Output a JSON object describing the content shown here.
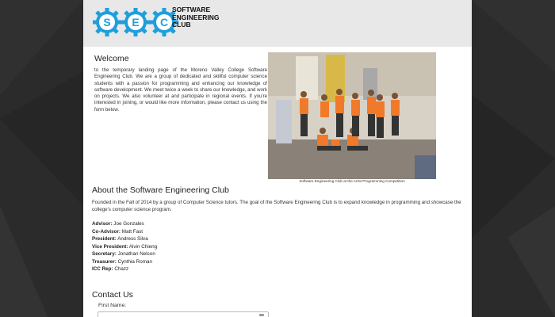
{
  "header": {
    "logo_letters": [
      "S",
      "E",
      "C"
    ],
    "logo_lines": [
      "SOFTWARE",
      "ENGINEERING",
      "CLUB"
    ]
  },
  "welcome": {
    "title": "Welcome",
    "text": "to the temporary landing page of the Moreno Valley College Software Engineering Club. We are a group of dedicated and skillful computer science students with a passion for programming and enhancing our knowledge of software development. We meet twice a week to share our knowledge, and work on projects. We also volunteer at and participate in regional events. If you're interested in joining, or would like more information, please contact us using the form below."
  },
  "photo": {
    "caption": "Software Engineering Club at the ACM Programming Competition"
  },
  "about": {
    "title": "About the Software Engineering Club",
    "text": "Founded in the Fall of 2014 by a group of Computer Science tutors. The goal of the Software Engineering Club is to expand knowledge in programming and showcase the college's computer science program.",
    "officers": [
      {
        "role": "Advisor:",
        "name": "Joe Gonzales"
      },
      {
        "role": "Co-Advisor:",
        "name": "Matt Fast"
      },
      {
        "role": "President:",
        "name": "Andress Silva"
      },
      {
        "role": "Vice President:",
        "name": "Alvin Chieng"
      },
      {
        "role": "Secretary:",
        "name": "Jonathan Nelson"
      },
      {
        "role": "Treasurer:",
        "name": "Cynthia Roman"
      },
      {
        "role": "ICC Rep:",
        "name": "Chazz"
      }
    ]
  },
  "contact": {
    "title": "Contact Us",
    "first_name_label": "First Name:"
  },
  "colors": {
    "logo_blue": "#1e9fdc",
    "shirt_orange": "#f07a2a",
    "background": "#2b2b2b"
  }
}
